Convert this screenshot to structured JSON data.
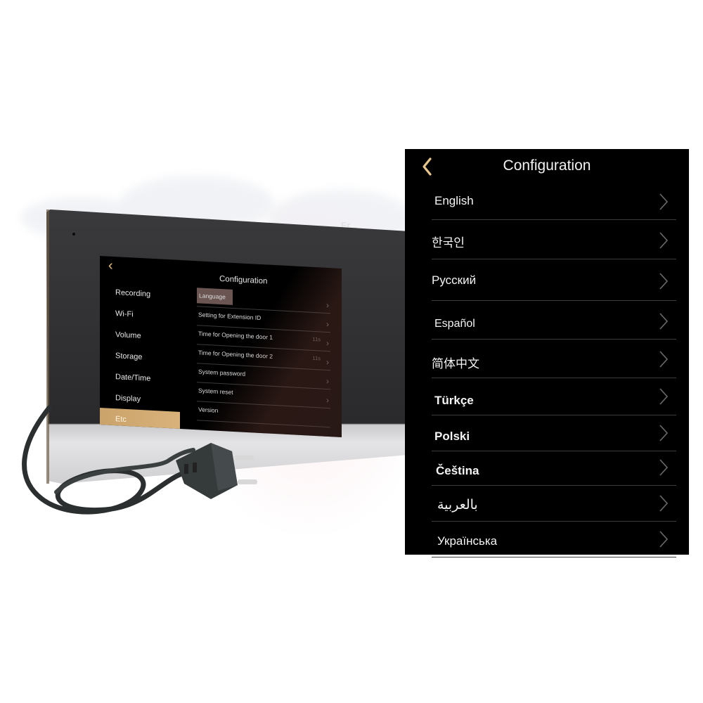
{
  "background": {
    "watermark_text": "Fr..."
  },
  "device_screen": {
    "back_icon": "chevron-left-icon",
    "title": "Configuration",
    "nav_items": [
      {
        "label": "Recording",
        "active": false
      },
      {
        "label": "Wi-Fi",
        "active": false
      },
      {
        "label": "Volume",
        "active": false
      },
      {
        "label": "Storage",
        "active": false
      },
      {
        "label": "Date/Time",
        "active": false
      },
      {
        "label": "Display",
        "active": false
      },
      {
        "label": "Etc",
        "active": true
      }
    ],
    "settings": [
      {
        "label": "Language",
        "value": "",
        "highlighted": true,
        "chevron": true
      },
      {
        "label": "Setting for Extension ID",
        "value": "",
        "highlighted": false,
        "chevron": true
      },
      {
        "label": "Time for Opening the door 1",
        "value": "11s",
        "highlighted": false,
        "chevron": true
      },
      {
        "label": "Time for Opening the door 2",
        "value": "11s",
        "highlighted": false,
        "chevron": true
      },
      {
        "label": "System  password",
        "value": "",
        "highlighted": false,
        "chevron": true
      },
      {
        "label": "System reset",
        "value": "",
        "highlighted": false,
        "chevron": true
      },
      {
        "label": "Version",
        "value": "",
        "highlighted": false,
        "chevron": false
      }
    ],
    "accent_color": "#d2ab72"
  },
  "language_panel": {
    "back_icon": "chevron-left-icon",
    "title": "Configuration",
    "languages": [
      {
        "label": "English"
      },
      {
        "label": "한국인"
      },
      {
        "label": "Русский"
      },
      {
        "label": "Español"
      },
      {
        "label": "简体中文"
      },
      {
        "label": "Türkçe"
      },
      {
        "label": "Polski"
      },
      {
        "label": "Čeština"
      },
      {
        "label": "بالعربية"
      },
      {
        "label": "Українська"
      }
    ],
    "accent_color": "#e8c58a",
    "chevron_color": "#6a6a6a",
    "divider_color": "#3c3c3c"
  }
}
